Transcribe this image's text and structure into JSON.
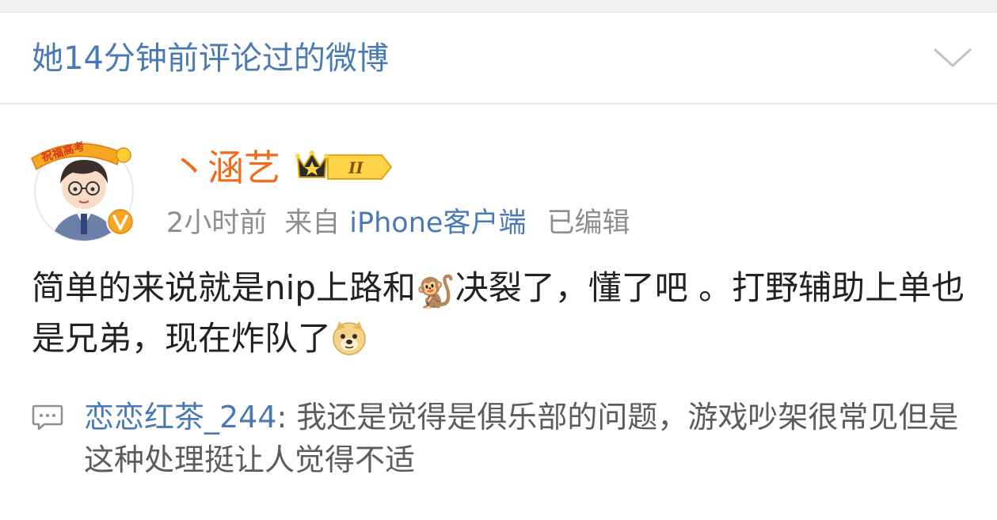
{
  "header": {
    "title": "她14分钟前评论过的微博",
    "expand_icon": "chevron-down-icon"
  },
  "post": {
    "avatar_icon": "cartoon-avatar-icon",
    "avatar_banner": "祝福高考",
    "author": "丶涵艺",
    "vip_level": "II",
    "time": "2小时前",
    "source_prefix": "来自",
    "source": "iPhone客户端",
    "edited": "已编辑",
    "text_part1": "简单的来说就是nip上路和",
    "monkey_emoji": "🐒",
    "text_part2": "决裂了，懂了吧 。打野辅助上单也是兄弟，现在炸队了",
    "doge_emoji": "doge-icon"
  },
  "comment": {
    "icon": "comment-icon",
    "commenter": "恋恋红茶_244",
    "separator": ": ",
    "text": "我还是觉得是俱乐部的问题，游戏吵架很常见但是这种处理挺让人觉得不适"
  },
  "colors": {
    "link_blue": "#4a7ab5",
    "author_orange": "#f26a1b",
    "meta_gray": "#8e8e8e",
    "body_text": "#222222"
  }
}
